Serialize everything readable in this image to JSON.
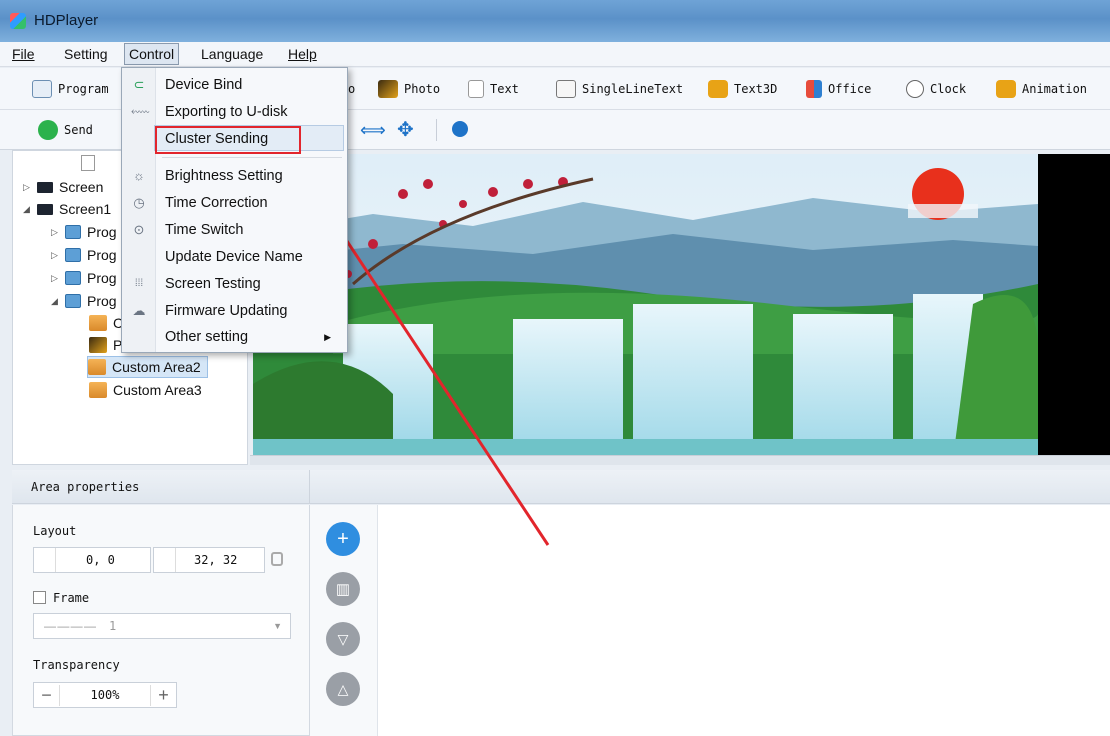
{
  "window": {
    "title": "HDPlayer"
  },
  "menubar": {
    "items": [
      "File",
      "Setting",
      "Control",
      "Language",
      "Help"
    ]
  },
  "toolbar1": {
    "program": "Program",
    "hidden_label": "o",
    "photo": "Photo",
    "text": "Text",
    "single_line_text": "SingleLineText",
    "text3d": "Text3D",
    "office": "Office",
    "clock": "Clock",
    "animation": "Animation"
  },
  "toolbar2": {
    "send": "Send"
  },
  "tree": {
    "screen": "Screen",
    "screen1": "Screen1",
    "prog_labels": [
      "Prog",
      "Prog",
      "Prog",
      "Prog"
    ],
    "area_labels": [
      "C",
      "P"
    ],
    "custom_area2": "Custom Area2",
    "custom_area3": "Custom Area3"
  },
  "control_menu": {
    "items": [
      {
        "label": "Device Bind",
        "icon": "magnet-icon"
      },
      {
        "label": "Exporting to U-disk",
        "icon": "usb-icon"
      },
      {
        "label": "Cluster Sending",
        "icon": "none"
      },
      {
        "label": "Brightness Setting",
        "icon": "bulb-icon"
      },
      {
        "label": "Time Correction",
        "icon": "clock-icon"
      },
      {
        "label": "Time Switch",
        "icon": "switch-icon"
      },
      {
        "label": "Update Device Name",
        "icon": "none"
      },
      {
        "label": "Screen Testing",
        "icon": "dots-icon"
      },
      {
        "label": "Firmware Updating",
        "icon": "cloud-icon"
      },
      {
        "label": "Other setting",
        "icon": "none"
      }
    ],
    "highlighted": "Cluster Sending"
  },
  "properties": {
    "title": "Area properties",
    "layout_label": "Layout",
    "position_value": "0, 0",
    "size_value": "32, 32",
    "frame_label": "Frame",
    "frame_value": "1",
    "transparency_label": "Transparency",
    "transparency_value": "100%"
  },
  "colors": {
    "titlebar": "#5b91c8",
    "highlight_box": "#e2252c",
    "round_button_blue": "#2f8ee0",
    "round_button_gray": "#9a9fa6"
  }
}
